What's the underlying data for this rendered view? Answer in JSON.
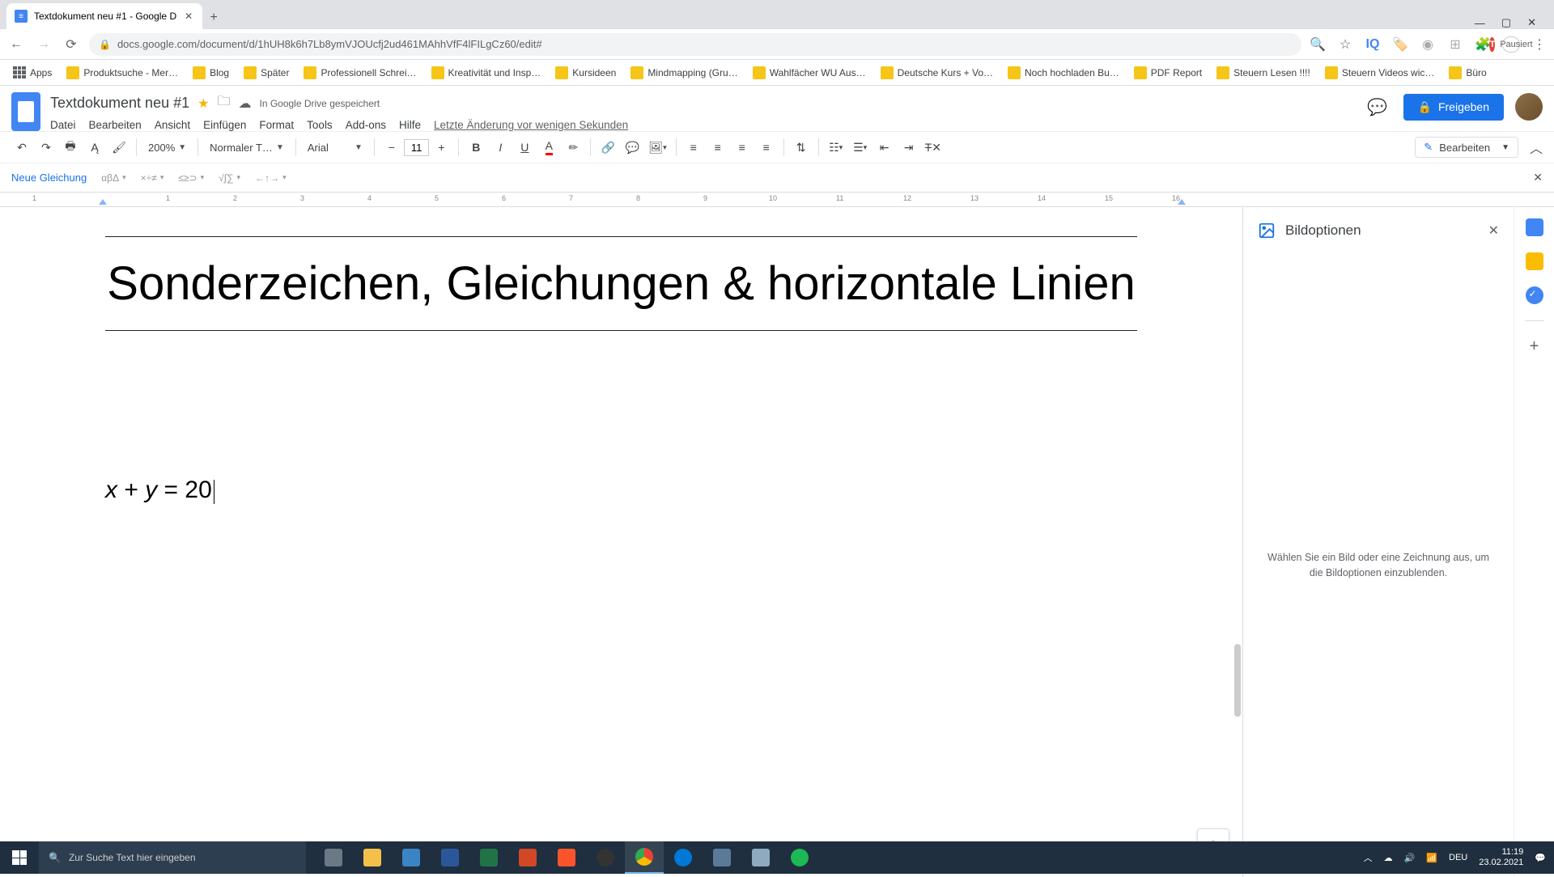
{
  "browser": {
    "tab_title": "Textdokument neu #1 - Google D",
    "url": "docs.google.com/document/d/1hUH8k6h7Lb8ymVJOUcfj2ud461MAhhVfF4lFILgCz60/edit#",
    "pausiert": "Pausiert"
  },
  "bookmarks": {
    "apps": "Apps",
    "items": [
      "Produktsuche - Mer…",
      "Blog",
      "Später",
      "Professionell Schrei…",
      "Kreativität und Insp…",
      "Kursideen",
      "Mindmapping  (Gru…",
      "Wahlfächer WU Aus…",
      "Deutsche Kurs + Vo…",
      "Noch hochladen Bu…",
      "PDF Report",
      "Steuern Lesen !!!!",
      "Steuern Videos wic…",
      "Büro"
    ]
  },
  "docs": {
    "title": "Textdokument neu #1",
    "saved": "In Google Drive gespeichert",
    "menu": {
      "file": "Datei",
      "edit": "Bearbeiten",
      "view": "Ansicht",
      "insert": "Einfügen",
      "format": "Format",
      "tools": "Tools",
      "addons": "Add-ons",
      "help": "Hilfe"
    },
    "last_edit": "Letzte Änderung vor wenigen Sekunden",
    "share": "Freigeben"
  },
  "toolbar": {
    "zoom": "200%",
    "style": "Normaler T…",
    "font": "Arial",
    "font_size": "11",
    "edit_mode": "Bearbeiten"
  },
  "equation": {
    "new": "Neue Gleichung",
    "g1": "αβΔ",
    "g2": "×÷≠",
    "g3": "≤≥⊃",
    "g4": "√∫∑",
    "g5": "←↑→"
  },
  "ruler": {
    "ticks": [
      "1",
      "1",
      "2",
      "3",
      "4",
      "5",
      "6",
      "7",
      "8",
      "9",
      "10",
      "11",
      "12",
      "13",
      "14",
      "15",
      "16"
    ]
  },
  "document": {
    "heading": "Sonderzeichen, Gleichungen & horizontale Linien",
    "equation_x": "x",
    "equation_plus": " + ",
    "equation_y": "y",
    "equation_eq": " = ",
    "equation_val": "20"
  },
  "sidepanel": {
    "title": "Bildoptionen",
    "empty": "Wählen Sie ein Bild oder eine Zeichnung aus, um die Bildoptionen einzublenden."
  },
  "taskbar": {
    "search_placeholder": "Zur Suche Text hier eingeben",
    "lang": "DEU",
    "time": "11:19",
    "date": "23.02.2021"
  }
}
